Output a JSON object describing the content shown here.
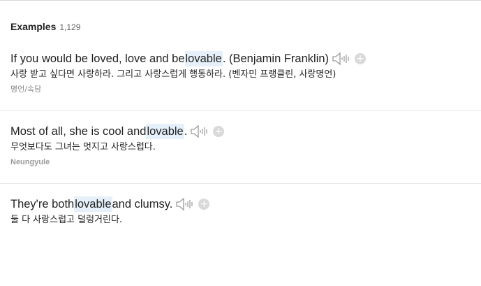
{
  "header": {
    "title": "Examples",
    "count": "1,129"
  },
  "examples": [
    {
      "pre": "If you would be loved, love and be ",
      "highlight": "lovable",
      "post": ". (Benjamin Franklin)",
      "translation": "사랑 받고 싶다면 사랑하라. 그리고 사랑스럽게 행동하라. (벤자민 프랭클린, 사랑명언)",
      "source": "명언/속담"
    },
    {
      "pre": "Most of all, she is cool and ",
      "highlight": "lovable",
      "post": ".",
      "translation": "무엇보다도 그녀는 멋지고 사랑스럽다.",
      "source": "Neungyule"
    },
    {
      "pre": "They're both ",
      "highlight": "lovable",
      "post": " and clumsy.",
      "translation": "둘 다 사랑스럽고 덜렁거린다.",
      "source": ""
    }
  ],
  "icons": {
    "speaker": "speaker-icon",
    "add": "add-icon",
    "add_glyph": "+"
  },
  "colors": {
    "highlight": "#e6f0fa",
    "icon_gray": "#9a9a9a",
    "divider": "#e6e6e6"
  }
}
